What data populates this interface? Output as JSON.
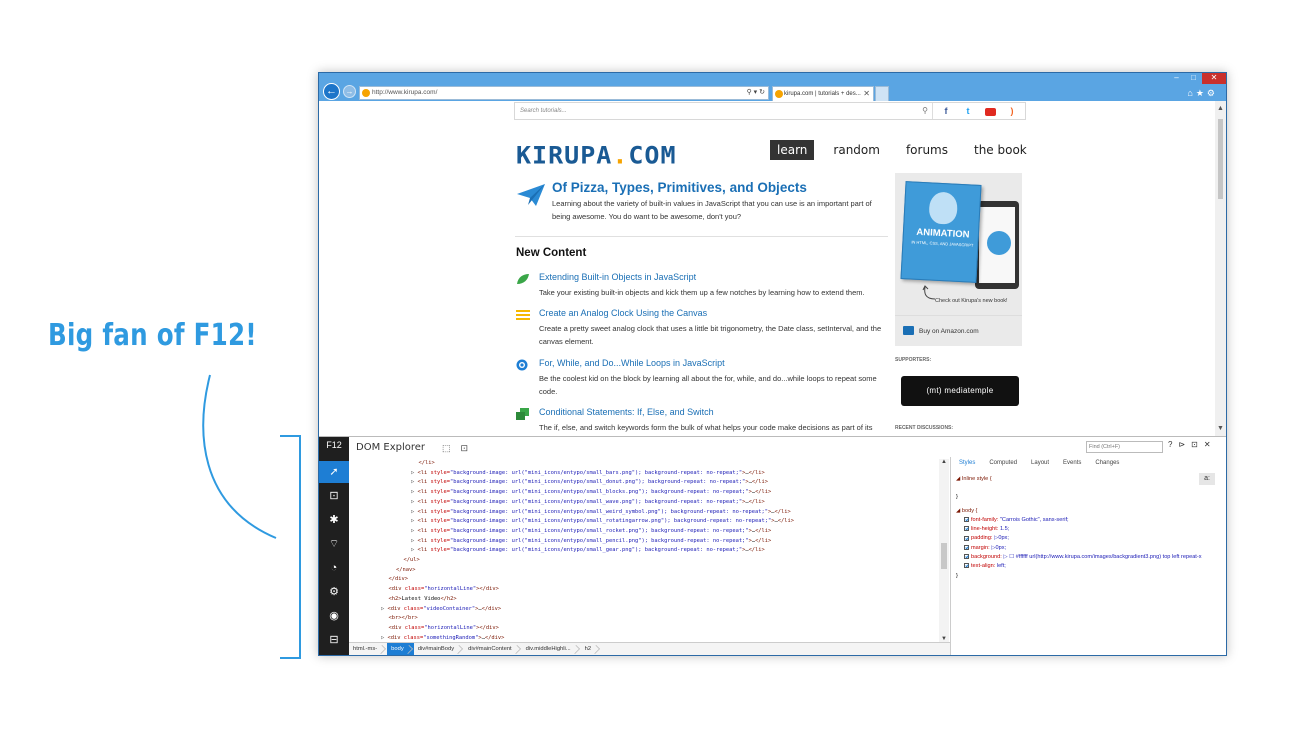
{
  "annotation": {
    "text": "Big fan of F12!"
  },
  "browser": {
    "url": "http://www.kirupa.com/",
    "tab_title": "kirupa.com | tutorials + des...",
    "nav_back": "←",
    "nav_fwd": "→",
    "addr_tools": "⚲ ▾ ↻",
    "tab_close": "✕",
    "winctl": {
      "min": "–",
      "max": "□",
      "close": "✕"
    },
    "right_tools": "⌂★⚙"
  },
  "site": {
    "search_placeholder": "Search tutorials...",
    "search_icon": "⚲",
    "social": {
      "facebook": "f",
      "twitter": "t",
      "rss": ")"
    },
    "logo_part1": "KIRUPA",
    "logo_dot": ".",
    "logo_part2": "COM",
    "nav": [
      "learn",
      "random",
      "forums",
      "the book"
    ],
    "featured": {
      "title": "Of Pizza, Types, Primitives, and Objects",
      "desc": "Learning about the variety of built-in values in JavaScript that you can use is an important part of being awesome. You do want to be awesome, don't you?"
    },
    "new_content_heading": "New Content",
    "items": [
      {
        "title": "Extending Built-in Objects in JavaScript",
        "desc": "Take your existing built-in objects and kick them up a few notches by learning how to extend them.",
        "icon": "leaf-icon",
        "color": "#3aa648"
      },
      {
        "title": "Create an Analog Clock Using the Canvas",
        "desc": "Create a pretty sweet analog clock that uses a little bit trigonometry, the Date class, setInterval, and the canvas element.",
        "icon": "menu-lines-icon",
        "color": "#f6b800"
      },
      {
        "title": "For, While, and Do...While Loops in JavaScript",
        "desc": "Be the coolest kid on the block by learning all about the for, while, and do...while loops to repeat some code.",
        "icon": "target-icon",
        "color": "#1e7ed4"
      },
      {
        "title": "Conditional Statements: If, Else, and Switch",
        "desc": "The if, else, and switch keywords form the bulk of what helps your code make decisions as part of its",
        "icon": "blocks-icon",
        "color": "#3aa648"
      }
    ],
    "sidebar": {
      "book_title": "ANIMATION",
      "book_subtitle": "IN HTML, CSS, AND JAVASCRIPT",
      "checkout": "Check out Kirupa's new book!",
      "amazon": "Buy on Amazon.com",
      "supporters": "SUPPORTERS:",
      "sponsor": "(mt) mediatemple",
      "recent": "RECENT DISCUSSIONS:"
    }
  },
  "devtools": {
    "f12_label": "F12",
    "tool_title": "DOM Explorer",
    "find_placeholder": "Find (Ctrl+F)",
    "toolbar_icons": "⬚⊡",
    "controls": "?⊳⊡✕",
    "rail_icons": [
      "➚",
      "⊡",
      "✱",
      "⌔",
      "◔",
      "⚙",
      "◉",
      "⊟"
    ],
    "dom_lines": [
      {
        "indent": 9,
        "arrow": "",
        "html": [
          [
            "tag",
            "</li>"
          ]
        ]
      },
      {
        "indent": 8,
        "arrow": "▷ ",
        "html": [
          [
            "tag",
            "<li "
          ],
          [
            "an",
            "style="
          ],
          [
            "av",
            "\"background-image: url(\"mini_icons/entypo/small_bars.png\"); background-repeat: no-repeat;\""
          ],
          [
            "tag",
            ">"
          ],
          [
            "tx",
            "…"
          ],
          [
            "tag",
            "</li>"
          ]
        ]
      },
      {
        "indent": 8,
        "arrow": "▷ ",
        "html": [
          [
            "tag",
            "<li "
          ],
          [
            "an",
            "style="
          ],
          [
            "av",
            "\"background-image: url(\"mini_icons/entypo/small_donut.png\"); background-repeat: no-repeat;\""
          ],
          [
            "tag",
            ">"
          ],
          [
            "tx",
            "…"
          ],
          [
            "tag",
            "</li>"
          ]
        ]
      },
      {
        "indent": 8,
        "arrow": "▷ ",
        "html": [
          [
            "tag",
            "<li "
          ],
          [
            "an",
            "style="
          ],
          [
            "av",
            "\"background-image: url(\"mini_icons/entypo/small_blocks.png\"); background-repeat: no-repeat;\""
          ],
          [
            "tag",
            ">"
          ],
          [
            "tx",
            "…"
          ],
          [
            "tag",
            "</li>"
          ]
        ]
      },
      {
        "indent": 8,
        "arrow": "▷ ",
        "html": [
          [
            "tag",
            "<li "
          ],
          [
            "an",
            "style="
          ],
          [
            "av",
            "\"background-image: url(\"mini_icons/entypo/small_wave.png\"); background-repeat: no-repeat;\""
          ],
          [
            "tag",
            ">"
          ],
          [
            "tx",
            "…"
          ],
          [
            "tag",
            "</li>"
          ]
        ]
      },
      {
        "indent": 8,
        "arrow": "▷ ",
        "html": [
          [
            "tag",
            "<li "
          ],
          [
            "an",
            "style="
          ],
          [
            "av",
            "\"background-image: url(\"mini_icons/entypo/small_weird_symbol.png\"); background-repeat: no-repeat;\""
          ],
          [
            "tag",
            ">"
          ],
          [
            "tx",
            "…"
          ],
          [
            "tag",
            "</li>"
          ]
        ]
      },
      {
        "indent": 8,
        "arrow": "▷ ",
        "html": [
          [
            "tag",
            "<li "
          ],
          [
            "an",
            "style="
          ],
          [
            "av",
            "\"background-image: url(\"mini_icons/entypo/small_rotatingarrow.png\"); background-repeat: no-repeat;\""
          ],
          [
            "tag",
            ">"
          ],
          [
            "tx",
            "…"
          ],
          [
            "tag",
            "</li>"
          ]
        ]
      },
      {
        "indent": 8,
        "arrow": "▷ ",
        "html": [
          [
            "tag",
            "<li "
          ],
          [
            "an",
            "style="
          ],
          [
            "av",
            "\"background-image: url(\"mini_icons/entypo/small_rocket.png\"); background-repeat: no-repeat;\""
          ],
          [
            "tag",
            ">"
          ],
          [
            "tx",
            "…"
          ],
          [
            "tag",
            "</li>"
          ]
        ]
      },
      {
        "indent": 8,
        "arrow": "▷ ",
        "html": [
          [
            "tag",
            "<li "
          ],
          [
            "an",
            "style="
          ],
          [
            "av",
            "\"background-image: url(\"mini_icons/entypo/small_pencil.png\"); background-repeat: no-repeat;\""
          ],
          [
            "tag",
            ">"
          ],
          [
            "tx",
            "…"
          ],
          [
            "tag",
            "</li>"
          ]
        ]
      },
      {
        "indent": 8,
        "arrow": "▷ ",
        "html": [
          [
            "tag",
            "<li "
          ],
          [
            "an",
            "style="
          ],
          [
            "av",
            "\"background-image: url(\"mini_icons/entypo/small_gear.png\"); background-repeat: no-repeat;\""
          ],
          [
            "tag",
            ">"
          ],
          [
            "tx",
            "…"
          ],
          [
            "tag",
            "</li>"
          ]
        ]
      },
      {
        "indent": 7,
        "arrow": "",
        "html": [
          [
            "tag",
            "</ul>"
          ]
        ]
      },
      {
        "indent": 6,
        "arrow": "",
        "html": [
          [
            "tag",
            "</nav>"
          ]
        ]
      },
      {
        "indent": 5,
        "arrow": "",
        "html": [
          [
            "tag",
            "</div>"
          ]
        ]
      },
      {
        "indent": 5,
        "arrow": "",
        "html": [
          [
            "tag",
            "<div "
          ],
          [
            "an",
            "class="
          ],
          [
            "av",
            "\"horizontalLine\""
          ],
          [
            "tag",
            "></div>"
          ]
        ]
      },
      {
        "indent": 5,
        "arrow": "",
        "html": [
          [
            "tag",
            "<h2>"
          ],
          [
            "tx",
            "Latest Video"
          ],
          [
            "tag",
            "</h2>"
          ]
        ]
      },
      {
        "indent": 4,
        "arrow": "▷ ",
        "html": [
          [
            "tag",
            "<div "
          ],
          [
            "an",
            "class="
          ],
          [
            "av",
            "\"videoContainer\""
          ],
          [
            "tag",
            ">"
          ],
          [
            "tx",
            "…"
          ],
          [
            "tag",
            "</div>"
          ]
        ]
      },
      {
        "indent": 5,
        "arrow": "",
        "html": [
          [
            "tag",
            "<br></br>"
          ]
        ]
      },
      {
        "indent": 5,
        "arrow": "",
        "html": [
          [
            "tag",
            "<div "
          ],
          [
            "an",
            "class="
          ],
          [
            "av",
            "\"horizontalLine\""
          ],
          [
            "tag",
            "></div>"
          ]
        ]
      },
      {
        "indent": 4,
        "arrow": "▷ ",
        "html": [
          [
            "tag",
            "<div "
          ],
          [
            "an",
            "class="
          ],
          [
            "av",
            "\"somethingRandom\""
          ],
          [
            "tag",
            ">"
          ],
          [
            "tx",
            "…"
          ],
          [
            "tag",
            "</div>"
          ]
        ]
      }
    ],
    "style_tabs": [
      "Styles",
      "Computed",
      "Layout",
      "Events",
      "Changes"
    ],
    "inline_style_label": "◢ Inline style  {",
    "close_brace": "}",
    "body_selector": "◢ body  {",
    "aa_label": "a:",
    "body_rules": [
      {
        "prop": "font-family:",
        "value": "\"Carrois Gothic\", sans-serif;"
      },
      {
        "prop": "line-height:",
        "value": "1.5;"
      },
      {
        "prop": "padding:",
        "value": "▷0px;"
      },
      {
        "prop": "margin:",
        "value": "▷0px;"
      },
      {
        "prop": "background:",
        "value": "▷ ☐ #ffffff url(http://www.kirupa.com/images/backgradient3.png) top left repeat-x"
      },
      {
        "prop": "text-align:",
        "value": "left;"
      }
    ],
    "breadcrumbs": [
      "html.-ms-",
      "body",
      "div#mainBody",
      "div#mainContent",
      "div.middleHighli...",
      "h2"
    ]
  }
}
